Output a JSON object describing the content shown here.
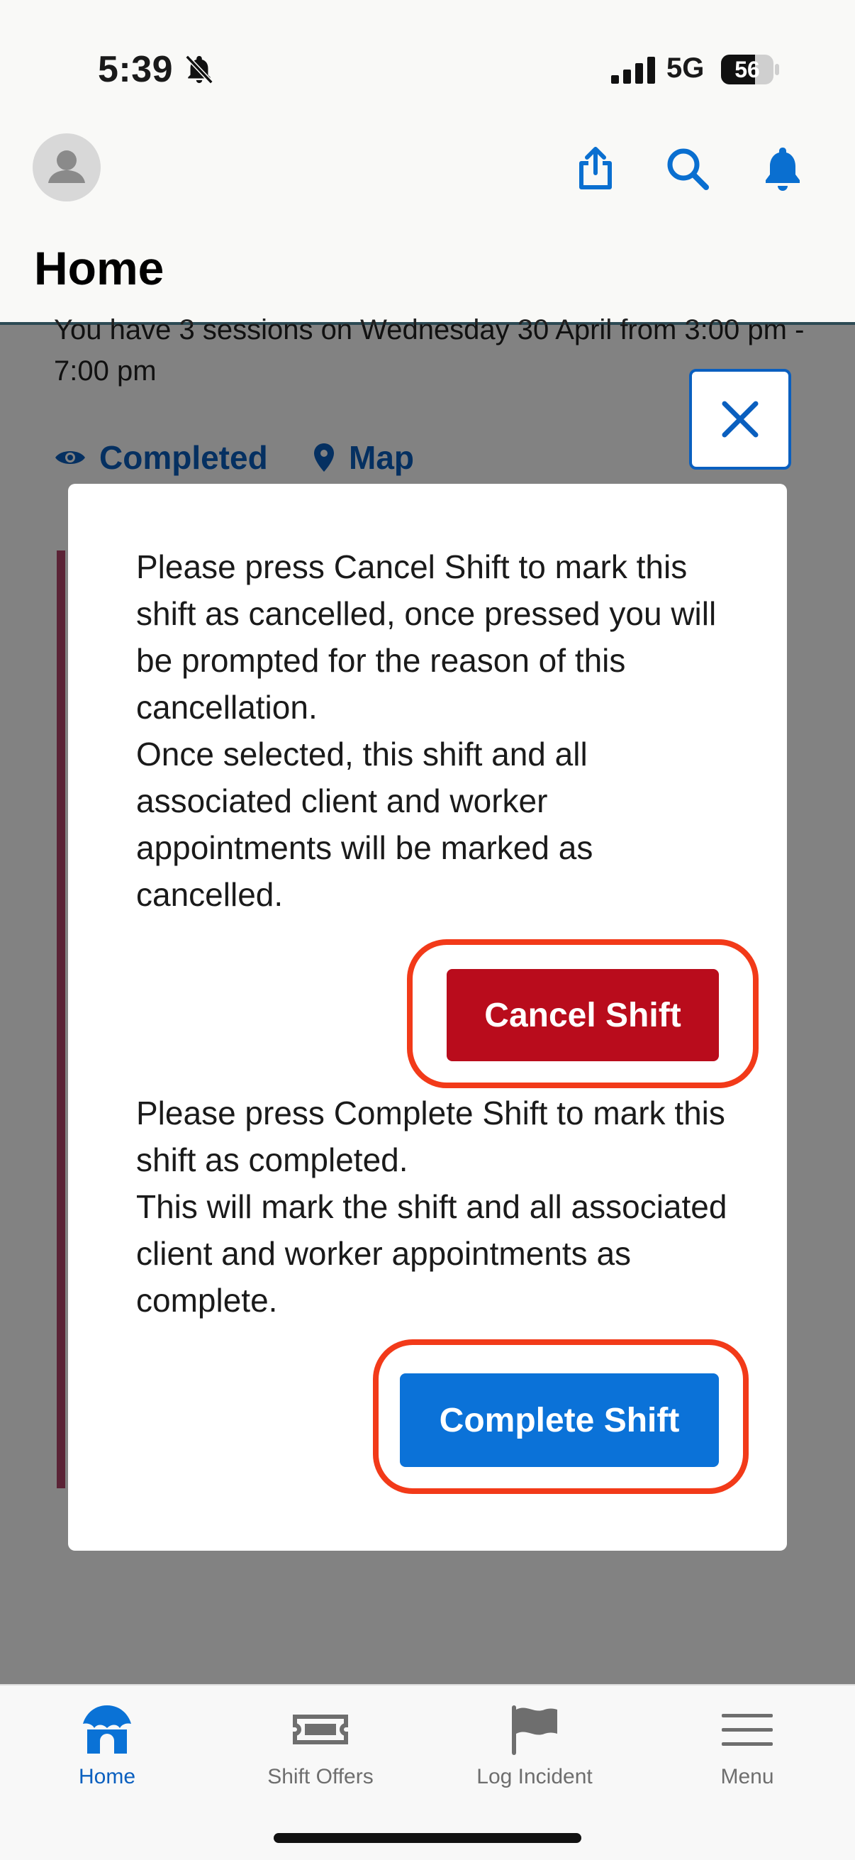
{
  "status_bar": {
    "time": "5:39",
    "network": "5G",
    "battery": "56"
  },
  "header": {
    "title": "Home",
    "icons": [
      "avatar",
      "share-icon",
      "search-icon",
      "bell-icon"
    ]
  },
  "background_card": {
    "session_text": "You have 3 sessions on Wednesday 30 April from 3:00 pm - 7:00 pm",
    "link_completed": "Completed",
    "link_map": "Map"
  },
  "modal": {
    "cancel_text": "Please press Cancel Shift to mark this shift as cancelled, once pressed you will be prompted for the reason of this cancellation.\nOnce selected, this shift and all associated client and worker appointments will be marked as cancelled.",
    "cancel_button": "Cancel Shift",
    "complete_text": "Please press Complete Shift to mark this shift as completed.\nThis will mark the shift and all associated client and worker appointments as complete.",
    "complete_button": "Complete Shift"
  },
  "tabbar": {
    "items": [
      {
        "label": "Home",
        "icon": "home-icon",
        "active": true
      },
      {
        "label": "Shift Offers",
        "icon": "ticket-icon",
        "active": false
      },
      {
        "label": "Log Incident",
        "icon": "flag-icon",
        "active": false
      },
      {
        "label": "Menu",
        "icon": "menu-icon",
        "active": false
      }
    ]
  },
  "colors": {
    "accent_blue": "#0b72d8",
    "cancel_red": "#b90c1c",
    "highlight_ring": "#f23a19",
    "card_accent": "#b3466a"
  }
}
